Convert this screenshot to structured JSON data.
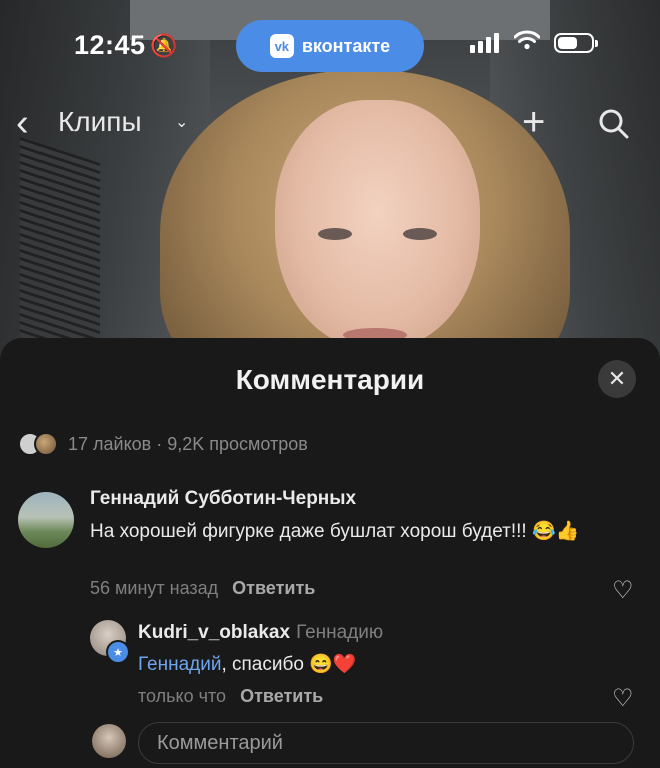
{
  "status_bar": {
    "time": "12:45",
    "app_pill_label": "вконтакте",
    "vk_logo_text": "vk"
  },
  "nav": {
    "title": "Клипы"
  },
  "comments_sheet": {
    "title": "Комментарии",
    "stats": "17 лайков · 9,2K просмотров",
    "comment": {
      "author": "Геннадий Субботин-Черных",
      "text": "На хорошей фигурке даже бушлат хорош будет!!! 😂👍",
      "time": "56 минут назад",
      "reply_label": "Ответить"
    },
    "reply": {
      "author": "Kudri_v_oblakax",
      "reply_to": "Геннадию",
      "mention": "Геннадий",
      "text": ", спасибо 😄❤️",
      "time": "только что",
      "reply_label": "Ответить"
    },
    "input_placeholder": "Комментарий"
  },
  "colors": {
    "accent": "#4a8ce6",
    "mention": "#6fa4ee",
    "sheet_bg": "#191919"
  }
}
